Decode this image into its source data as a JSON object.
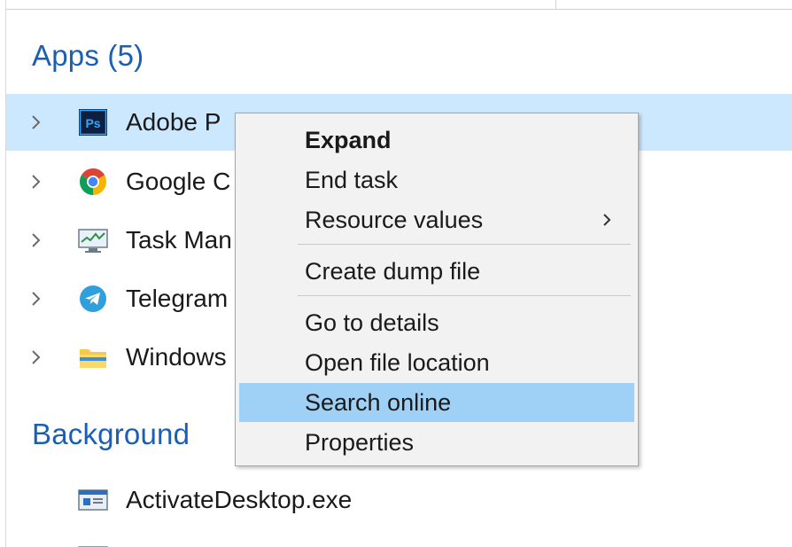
{
  "groups": {
    "apps_title": "Apps (5)",
    "background_title": "Background"
  },
  "apps": [
    {
      "label": "Adobe P",
      "icon": "photoshop-icon",
      "selected": true
    },
    {
      "label": "Google C",
      "icon": "chrome-icon",
      "selected": false
    },
    {
      "label": "Task Man",
      "icon": "task-manager-icon",
      "selected": false
    },
    {
      "label": "Telegram",
      "icon": "telegram-icon",
      "selected": false
    },
    {
      "label": "Windows",
      "icon": "explorer-folder-icon",
      "selected": false
    }
  ],
  "background_processes": [
    {
      "label": "ActivateDesktop.exe",
      "icon": "app-window-icon"
    }
  ],
  "context_menu": {
    "items": [
      {
        "label": "Expand",
        "bold": true
      },
      {
        "label": "End task"
      },
      {
        "label": "Resource values",
        "submenu": true
      },
      {
        "label": "Create dump file"
      },
      {
        "label": "Go to details"
      },
      {
        "label": "Open file location"
      },
      {
        "label": "Search online",
        "highlighted": true
      },
      {
        "label": "Properties"
      }
    ]
  },
  "colors": {
    "group_header": "#1b5fb4",
    "selected_row": "#cce8ff",
    "menu_highlight": "#9fd0f5",
    "menu_background": "#f2f2f2"
  }
}
